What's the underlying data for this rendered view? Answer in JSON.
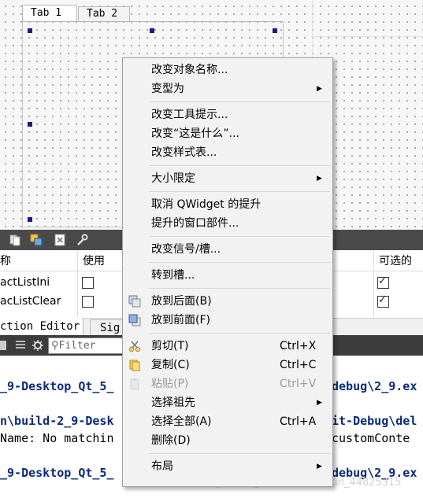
{
  "designer": {
    "tabs": [
      "Tab 1",
      "Tab 2"
    ]
  },
  "action_editor": {
    "columns": [
      "称",
      "使用",
      "可选的"
    ],
    "rows": [
      {
        "name": "actListIni",
        "used": false,
        "checkable": true
      },
      {
        "name": "acListClear",
        "used": false,
        "checkable": true
      }
    ]
  },
  "bottom_tabs": [
    "ction Editor",
    "Sig"
  ],
  "issues": {
    "filter_placeholder": "Filter"
  },
  "output_lines": [
    {
      "text": "_9-Desktop_Qt_5_",
      "right": "debug\\2_9.ex",
      "style": "bold-blue"
    },
    {
      "text": "n\\build-2_9-Desk",
      "right": "it-Debug\\del",
      "style": "bold-blue"
    },
    {
      "text": "Name: No matchin",
      "right": "customConte",
      "style": "normal"
    },
    {
      "text": "_9-Desktop_Qt_5_",
      "right": "debug\\2_9.ex",
      "style": "bold-blue"
    }
  ],
  "watermark": "https://blog.csdn.net/weixin_44825315",
  "context_menu": {
    "groups": [
      [
        {
          "label": "改变对象名称...",
          "shortcut": "",
          "submenu": false,
          "enabled": true,
          "icon": ""
        },
        {
          "label": "变型为",
          "shortcut": "",
          "submenu": true,
          "enabled": true,
          "icon": ""
        }
      ],
      [
        {
          "label": "改变工具提示...",
          "shortcut": "",
          "submenu": false,
          "enabled": true,
          "icon": ""
        },
        {
          "label": "改变“这是什么”...",
          "shortcut": "",
          "submenu": false,
          "enabled": true,
          "icon": ""
        },
        {
          "label": "改变样式表...",
          "shortcut": "",
          "submenu": false,
          "enabled": true,
          "icon": ""
        }
      ],
      [
        {
          "label": "大小限定",
          "shortcut": "",
          "submenu": true,
          "enabled": true,
          "icon": ""
        }
      ],
      [
        {
          "label": "取消 QWidget 的提升",
          "shortcut": "",
          "submenu": false,
          "enabled": true,
          "icon": ""
        },
        {
          "label": "提升的窗口部件...",
          "shortcut": "",
          "submenu": false,
          "enabled": true,
          "icon": ""
        }
      ],
      [
        {
          "label": "改变信号/槽...",
          "shortcut": "",
          "submenu": false,
          "enabled": true,
          "icon": ""
        }
      ],
      [
        {
          "label": "转到槽...",
          "shortcut": "",
          "submenu": false,
          "enabled": true,
          "icon": ""
        }
      ],
      [
        {
          "label": "放到后面(B)",
          "shortcut": "",
          "submenu": false,
          "enabled": true,
          "icon": "send-to-back-icon"
        },
        {
          "label": "放到前面(F)",
          "shortcut": "",
          "submenu": false,
          "enabled": true,
          "icon": "bring-to-front-icon"
        }
      ],
      [
        {
          "label": "剪切(T)",
          "shortcut": "Ctrl+X",
          "submenu": false,
          "enabled": true,
          "icon": "scissors-icon"
        },
        {
          "label": "复制(C)",
          "shortcut": "Ctrl+C",
          "submenu": false,
          "enabled": true,
          "icon": "copy-icon"
        },
        {
          "label": "粘贴(P)",
          "shortcut": "Ctrl+V",
          "submenu": false,
          "enabled": false,
          "icon": "paste-icon"
        },
        {
          "label": "选择祖先",
          "shortcut": "",
          "submenu": true,
          "enabled": true,
          "icon": ""
        },
        {
          "label": "选择全部(A)",
          "shortcut": "Ctrl+A",
          "submenu": false,
          "enabled": true,
          "icon": ""
        },
        {
          "label": "删除(D)",
          "shortcut": "",
          "submenu": false,
          "enabled": true,
          "icon": ""
        }
      ],
      [
        {
          "label": "布局",
          "shortcut": "",
          "submenu": true,
          "enabled": true,
          "icon": ""
        }
      ]
    ]
  },
  "colors": {
    "menu_bg": "#f2f2f2",
    "toolbar_dark": "#4a4a4a",
    "output_blue": "#0a2a7a",
    "handle": "#1a1a8c"
  }
}
